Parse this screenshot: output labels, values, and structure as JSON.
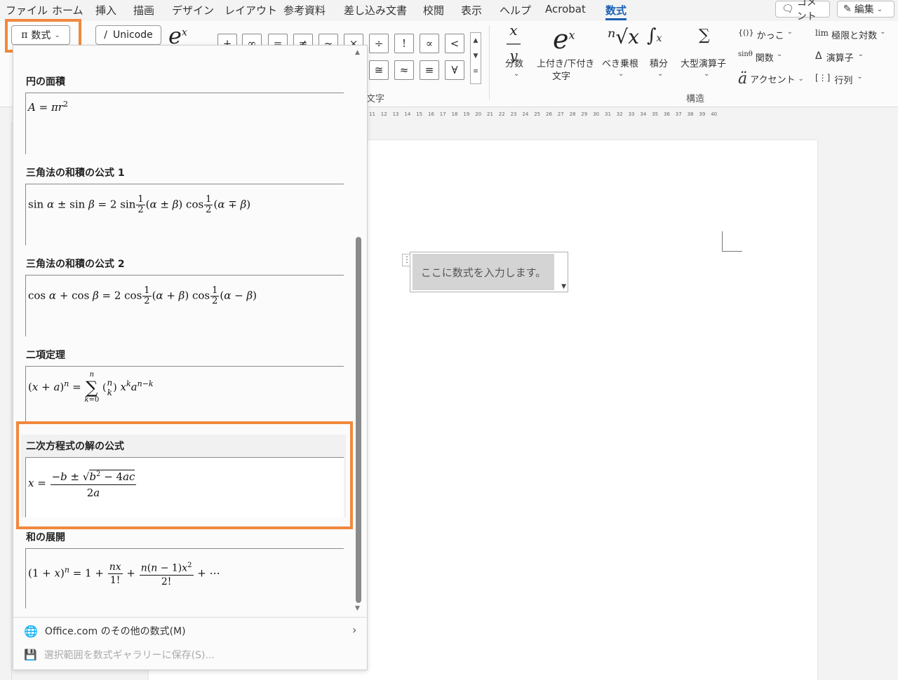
{
  "menu": {
    "items": [
      "ファイル",
      "ホーム",
      "挿入",
      "描画",
      "デザイン",
      "レイアウト",
      "参考資料",
      "差し込み文書",
      "校閲",
      "表示",
      "ヘルプ",
      "Acrobat",
      "数式"
    ],
    "comment_label": "コメント",
    "edit_label": "編集"
  },
  "ribbon": {
    "equation_label": "数式",
    "unicode_label": "Unicode",
    "symbols_row1": [
      "+",
      "∞",
      "=",
      "≠",
      "~",
      "×",
      "÷",
      "!",
      "∝",
      "<"
    ],
    "symbols_row2": [
      "≅",
      "≈",
      "≡",
      "∀"
    ],
    "symbols_group_label": "文字",
    "fraction_label": "分数",
    "script_label": "上付き/下付き",
    "script_label2": "文字",
    "radical_label": "べき乗根",
    "integral_label": "積分",
    "large_op_label": "大型演算子",
    "bracket_label": "かっこ",
    "function_label": "関数",
    "accent_label": "アクセント",
    "limit_label": "極限と対数",
    "operator_label": "演算子",
    "matrix_label": "行列",
    "structure_group_label": "構造"
  },
  "ruler": {
    "ticks": [
      "11",
      "12",
      "13",
      "14",
      "15",
      "16",
      "17",
      "18",
      "19",
      "20",
      "21",
      "22",
      "23",
      "24",
      "25",
      "26",
      "27",
      "28",
      "29",
      "30",
      "31",
      "32",
      "33",
      "34",
      "35",
      "36",
      "37",
      "38",
      "39",
      "40"
    ]
  },
  "document": {
    "placeholder": "ここに数式を入力します。"
  },
  "gallery": {
    "sections": [
      {
        "title": "円の面積"
      },
      {
        "title": "三角法の和積の公式 1"
      },
      {
        "title": "三角法の和積の公式 2"
      },
      {
        "title": "二項定理"
      },
      {
        "title": "二次方程式の解の公式"
      },
      {
        "title": "和の展開"
      }
    ],
    "more_label": "Office.com のその他の数式(M)",
    "save_label": "選択範囲を数式ギャラリーに保存(S)..."
  },
  "colors": {
    "highlight": "#f0883e",
    "accent": "#1a5fb4"
  }
}
